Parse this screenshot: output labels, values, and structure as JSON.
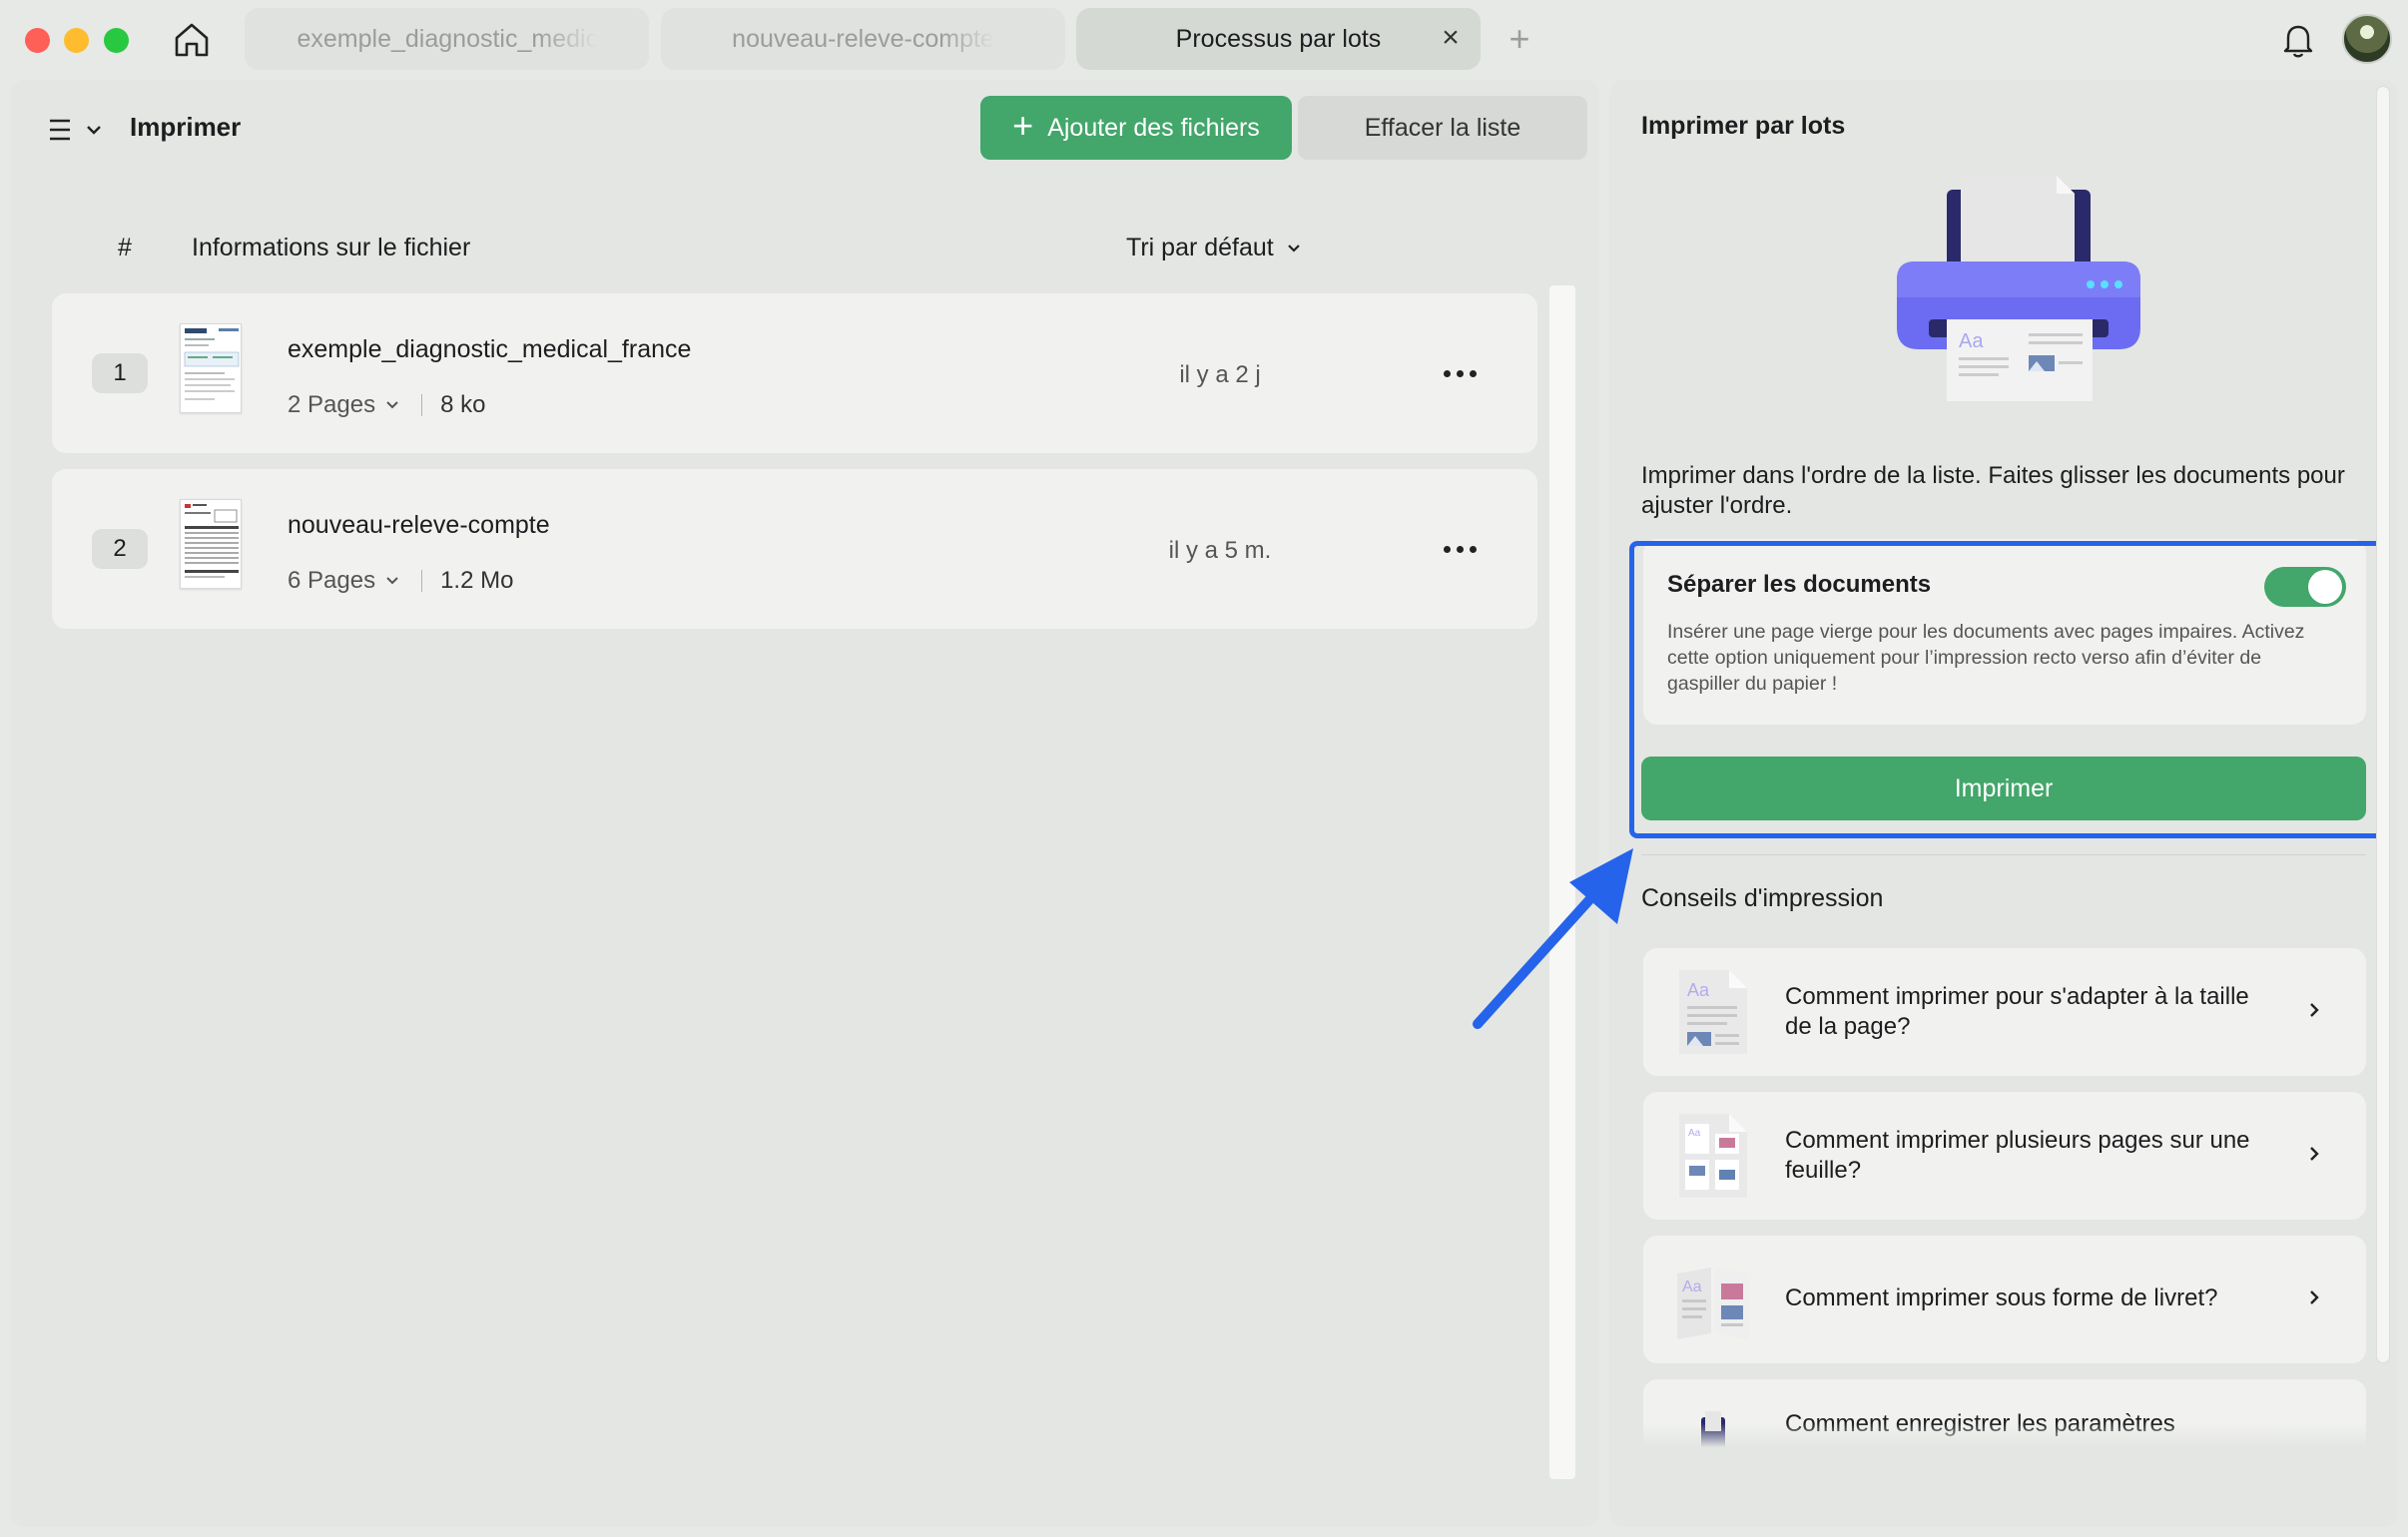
{
  "window": {
    "tabs": [
      {
        "label": "exemple_diagnostic_medical_france"
      },
      {
        "label": "nouveau-releve-compte"
      },
      {
        "label": "Processus par lots"
      }
    ],
    "close_tab_glyph": "×",
    "new_tab_glyph": "+"
  },
  "left": {
    "title": "Imprimer",
    "add_files_label": "Ajouter des fichiers",
    "clear_list_label": "Effacer la liste",
    "columns": {
      "number": "#",
      "info": "Informations sur le fichier",
      "sort": "Tri par défaut"
    },
    "files": [
      {
        "index": "1",
        "name": "exemple_diagnostic_medical_france",
        "pages": "2 Pages",
        "size": "8 ko",
        "time": "il y a 2 j"
      },
      {
        "index": "2",
        "name": "nouveau-releve-compte",
        "pages": "6 Pages",
        "size": "1.2 Mo",
        "time": "il y a 5 m."
      }
    ]
  },
  "right": {
    "title": "Imprimer par lots",
    "description": "Imprimer dans l'ordre de la liste. Faites glisser les documents pour ajuster l'ordre.",
    "separate": {
      "title": "Séparer les documents",
      "description": "Insérer une page vierge pour les documents avec pages impaires. Activez cette option uniquement pour l’impression recto verso afin d’éviter de gaspiller du papier !",
      "enabled": true
    },
    "print_label": "Imprimer",
    "tips_title": "Conseils d'impression",
    "tips": [
      {
        "label": "Comment imprimer pour s'adapter à la taille de la page?"
      },
      {
        "label": "Comment imprimer plusieurs pages sur une feuille?"
      },
      {
        "label": "Comment imprimer sous forme de livret?"
      },
      {
        "label": "Comment enregistrer les paramètres"
      }
    ]
  },
  "colors": {
    "accent_green": "#43a66b",
    "highlight_blue": "#2563eb",
    "printer_purple": "#6b6cf2"
  },
  "icons": [
    "home-icon",
    "bell-icon",
    "hamburger-icon",
    "chevron-down-icon",
    "plus-icon",
    "more-icon",
    "chevron-right-icon",
    "close-icon",
    "printer-illustration"
  ]
}
